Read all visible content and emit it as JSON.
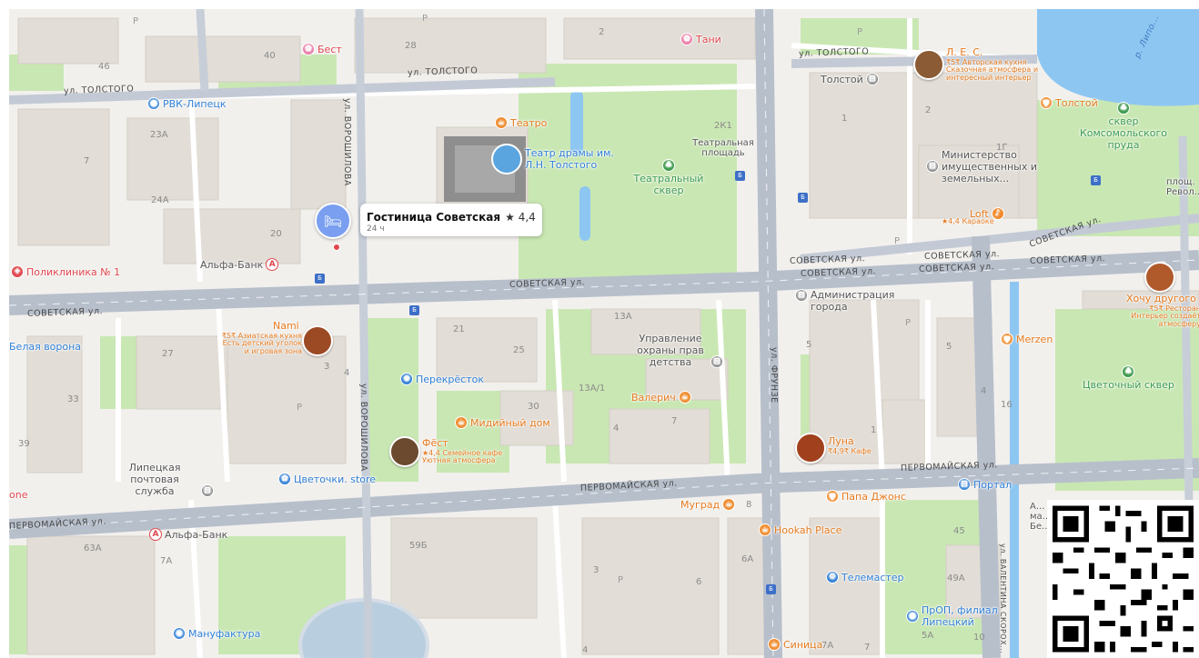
{
  "streets": {
    "tolstogo_w": "ул. ТОЛСТОГО",
    "tolstogo_c": "ул. ТОЛСТОГО",
    "tolstogo_e": "ул. ТОЛСТОГО",
    "sovetskaya_w": "СОВЕТСКАЯ ул.",
    "sovetskaya_c": "СОВЕТСКАЯ ул.",
    "sovetskaya_e1": "СОВЕТСКАЯ ул.",
    "sovetskaya_e2": "СОВЕТСКАЯ ул.",
    "sovetskaya_e3": "СОВЕТСКАЯ ул.",
    "sovetskaya_e4": "СОВЕТСКАЯ ул.",
    "sovetskaya_e5": "СОВЕТСКАЯ ул.",
    "sovetskaya_ne": "СОВЕТСКАЯ ул.",
    "pervomayskaya_w": "ПЕРВОМАЙСКАЯ ул.",
    "pervomayskaya_c": "ПЕРВОМАЙСКАЯ ул.",
    "pervomayskaya_e": "ПЕРВОМАЙСКАЯ ул.",
    "voroshilova_n": "ул. ВОРОШИЛОВА",
    "voroshilova_s": "ул. ВОРОШИЛОВА",
    "frunze": "ул. ФРУНЗЕ",
    "valentina": "ул. ВАЛЕНТИНА СКОРОХ...",
    "lipa": "р. Липо..."
  },
  "hotel": {
    "name": "Гостиница Советская",
    "rating": "★ 4,4",
    "hours": "24 ч"
  },
  "pois": {
    "best": "Бест",
    "tani": "Тани",
    "rvk": "РВК-Липецк",
    "teatro": "Театро",
    "theater": "Театр драмы им. Л.Н. Толстого",
    "teatral_ploshad": "Театральная площадь",
    "teatral_skver": "Театральный сквер",
    "les_name": "Л. Е. С.",
    "les_desc": "₹5₹ Авторская кухня Сказочная атмосфера и интересный интерьер",
    "tolstoy_ctr": "Толстой",
    "tolstoy_cafe": "Толстой",
    "skver_komsomol": "сквер Комсомольского пруда",
    "ministry": "Министерство имущественных и земельных...",
    "loft": "Loft",
    "loft_desc": "★4,4 Караоке",
    "poliklinika": "Поликлиника № 1",
    "alfa1": "Альфа-Банк",
    "admin": "Администрация города",
    "hochu": "Хочу другого",
    "hochu_desc": "₹5₹ Ресторан Интерьер создаёт атмосферу",
    "nami": "Nami",
    "nami_desc": "₹5₹ Азиатская кухня Есть детский уголок и игровая зона",
    "belaya": "Белая ворона",
    "upravlenie": "Управление охраны прав детства",
    "merzen": "Merzen",
    "perekrestok": "Перекрёсток",
    "valerich": "Валерич",
    "cvetochny": "Цветочный сквер",
    "midiyny": "Мидийный дом",
    "fest": "Фёст",
    "fest_desc": "★4,4 Семейное кафе Уютная атмосфера",
    "luna": "Луна",
    "luna_desc": "₹4,9₹ Кафе",
    "lipetsk_post": "Липецкая почтовая служба",
    "cvetochki": "Цветочки. store",
    "one": "one",
    "portal": "Портал",
    "papa": "Папа Джонс",
    "murgrad": "Муград",
    "hookah": "Hookah Place",
    "alfa2": "Альфа-Банк",
    "telemaster": "Телемастер",
    "prop": "ПрОП, филиал Липецкий",
    "manufaktura": "Мануфактура",
    "sinitsa": "Синица",
    "plosh": "площ. Револ...",
    "abc": "А... ма... Бе..."
  },
  "numbers": [
    "40",
    "28",
    "2",
    "46",
    "23А",
    "7",
    "24А",
    "20",
    "2К1",
    "1",
    "2",
    "1Г",
    "21",
    "25",
    "13А",
    "13А/1",
    "30",
    "4",
    "7",
    "27",
    "33",
    "3",
    "39",
    "1",
    "16",
    "63А",
    "7А",
    "59Б",
    "3",
    "6",
    "8",
    "6А",
    "4",
    "7А",
    "7",
    "49А",
    "45",
    "5",
    "10",
    "5А",
    "5",
    "4",
    "4"
  ],
  "parking": "Р",
  "bus": "Б",
  "colors": {
    "road": "#b8c0cc",
    "minor_road": "#ffffff",
    "building": "#e3dfd9",
    "park": "#c7e7b0",
    "water": "#89c3f0",
    "poi_orange": "#e57a1e",
    "poi_blue": "#2f7fd6",
    "poi_green": "#3a9a4b",
    "poi_red": "#e0464c",
    "hotel_pin": "#7a9ff0"
  }
}
